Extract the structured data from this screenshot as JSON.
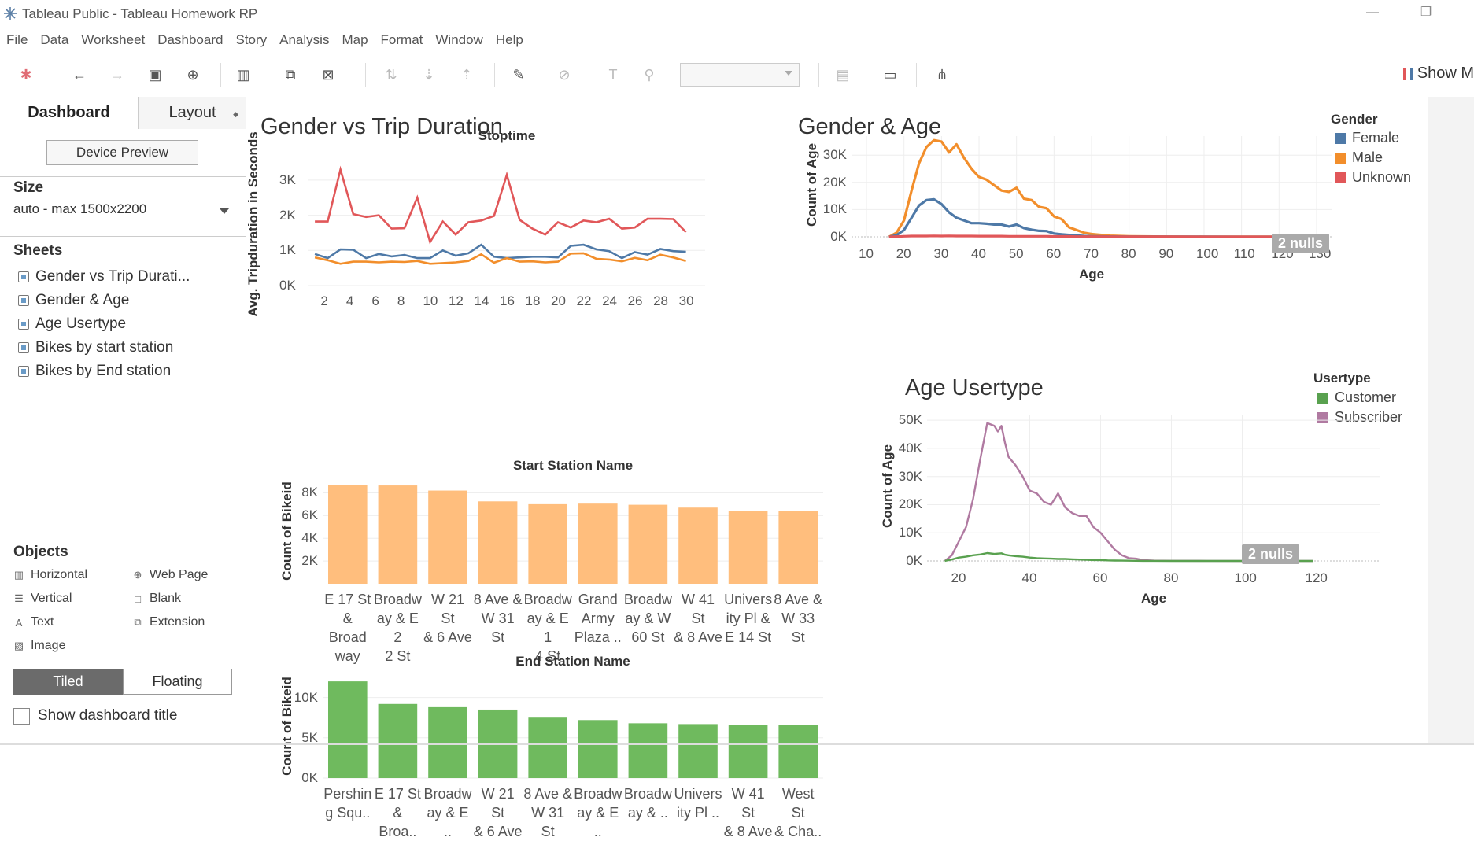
{
  "window": {
    "title": "Tableau Public - Tableau Homework RP"
  },
  "menu": [
    "File",
    "Data",
    "Worksheet",
    "Dashboard",
    "Story",
    "Analysis",
    "Map",
    "Format",
    "Window",
    "Help"
  ],
  "toolbar": {
    "show_me": "Show M"
  },
  "left_pane": {
    "tabs": {
      "dashboard": "Dashboard",
      "layout": "Layout"
    },
    "device_preview": "Device Preview",
    "size": {
      "label": "Size",
      "value": "auto - max 1500x2200"
    },
    "sheets_label": "Sheets",
    "sheets": [
      "Gender vs Trip Durati...",
      "Gender & Age",
      "Age Usertype",
      "Bikes by  start station",
      "Bikes by  End station"
    ],
    "objects_label": "Objects",
    "objects": [
      {
        "label": "Horizontal",
        "icon": "horizontal-container-icon"
      },
      {
        "label": "Web Page",
        "icon": "globe-icon"
      },
      {
        "label": "Vertical",
        "icon": "vertical-container-icon"
      },
      {
        "label": "Blank",
        "icon": "blank-icon"
      },
      {
        "label": "Text",
        "icon": "text-icon"
      },
      {
        "label": "Extension",
        "icon": "puzzle-icon"
      },
      {
        "label": "Image",
        "icon": "image-icon"
      }
    ],
    "tiled": "Tiled",
    "floating": "Floating",
    "show_title": "Show dashboard title"
  },
  "dashboard": {
    "gender_trip_title": "Gender vs Trip Duration",
    "gender_age_title": "Gender & Age",
    "age_usertype_title": "Age Usertype",
    "gender_legend": {
      "title": "Gender",
      "items": [
        "Female",
        "Male",
        "Unknown"
      ]
    },
    "usertype_legend": {
      "title": "Usertype",
      "items": [
        "Customer",
        "Subscriber"
      ]
    },
    "nulls_label": "2 nulls"
  },
  "colors": {
    "female": "#4e79a7",
    "male": "#f28e2b",
    "unknown": "#e15759",
    "customer": "#59a14f",
    "subscriber": "#b07aa1",
    "start_bar": "#ffbe7d",
    "end_bar": "#6fba5e"
  },
  "chart_data": [
    {
      "type": "line",
      "title": "Stoptime",
      "ylabel": "Avg. Tripduration in Seconds",
      "x": [
        1,
        2,
        3,
        4,
        5,
        6,
        7,
        8,
        9,
        10,
        11,
        12,
        13,
        14,
        15,
        16,
        17,
        18,
        19,
        20,
        21,
        22,
        23,
        24,
        25,
        26,
        27,
        28,
        29,
        30,
        31
      ],
      "xticks": [
        "2",
        "4",
        "6",
        "8",
        "10",
        "12",
        "14",
        "16",
        "18",
        "20",
        "22",
        "24",
        "26",
        "28",
        "30"
      ],
      "yticks": [
        "0K",
        "1K",
        "2K",
        "3K"
      ],
      "ylim": [
        0,
        3400
      ],
      "series": [
        {
          "name": "Unknown",
          "values": [
            1820,
            1820,
            3300,
            2030,
            1950,
            2000,
            1620,
            1630,
            2500,
            1240,
            1820,
            1450,
            1800,
            1850,
            1980,
            3150,
            1870,
            1620,
            1450,
            1800,
            1650,
            1850,
            1800,
            1900,
            1620,
            1650,
            1900,
            1900,
            1890,
            1520,
            null
          ]
        },
        {
          "name": "Female",
          "values": [
            900,
            780,
            1030,
            1020,
            780,
            900,
            830,
            870,
            780,
            780,
            1000,
            850,
            920,
            1160,
            820,
            780,
            800,
            820,
            820,
            800,
            1130,
            1160,
            1030,
            980,
            780,
            950,
            880,
            1040,
            980,
            960,
            null
          ]
        },
        {
          "name": "Male",
          "values": [
            800,
            720,
            620,
            680,
            680,
            660,
            680,
            670,
            700,
            620,
            640,
            660,
            700,
            890,
            650,
            780,
            680,
            690,
            660,
            680,
            910,
            920,
            760,
            740,
            690,
            790,
            720,
            880,
            800,
            700,
            null
          ]
        }
      ]
    },
    {
      "type": "line",
      "xlabel": "Age",
      "ylabel": "Count of Age",
      "xticks": [
        "10",
        "20",
        "30",
        "40",
        "50",
        "60",
        "70",
        "80",
        "90",
        "100",
        "110",
        "120",
        "130"
      ],
      "yticks": [
        "0K",
        "10K",
        "20K",
        "30K"
      ],
      "xlim": [
        6,
        134
      ],
      "ylim": [
        0,
        37000
      ],
      "x": [
        16,
        18,
        20,
        22,
        24,
        26,
        28,
        30,
        32,
        34,
        36,
        38,
        40,
        42,
        44,
        46,
        48,
        50,
        52,
        54,
        56,
        58,
        60,
        62,
        64,
        66,
        68,
        70,
        75,
        80,
        90,
        100,
        110,
        119,
        120,
        121,
        130
      ],
      "series": [
        {
          "name": "Male",
          "values": [
            0,
            1500,
            6000,
            17000,
            27000,
            33000,
            35500,
            35000,
            31000,
            34000,
            29000,
            25000,
            22000,
            21000,
            19000,
            17000,
            16500,
            18000,
            14000,
            13500,
            11000,
            10500,
            7500,
            6500,
            3500,
            2500,
            1500,
            1000,
            400,
            200,
            100,
            50,
            30,
            20,
            200,
            20,
            0
          ]
        },
        {
          "name": "Female",
          "values": [
            0,
            600,
            2500,
            7000,
            11500,
            13500,
            13800,
            12000,
            9000,
            7000,
            6000,
            5000,
            5000,
            4800,
            4500,
            4500,
            3800,
            4500,
            3200,
            2600,
            2200,
            2100,
            1200,
            900,
            700,
            500,
            300,
            200,
            100,
            50,
            30,
            20,
            10,
            5,
            5,
            5,
            0
          ]
        },
        {
          "name": "Unknown",
          "values": [
            0,
            100,
            200,
            300,
            300,
            300,
            350,
            300,
            350,
            300,
            300,
            300,
            250,
            250,
            250,
            250,
            200,
            200,
            200,
            200,
            200,
            200,
            150,
            150,
            150,
            100,
            100,
            100,
            50,
            30,
            20,
            10,
            10,
            10,
            10,
            10,
            0
          ]
        }
      ]
    },
    {
      "type": "line",
      "xlabel": "Age",
      "ylabel": "Count of Age",
      "xticks": [
        "20",
        "40",
        "60",
        "80",
        "100",
        "120"
      ],
      "yticks": [
        "0K",
        "10K",
        "20K",
        "30K",
        "40K",
        "50K"
      ],
      "xlim": [
        11,
        139
      ],
      "ylim": [
        0,
        52000
      ],
      "x": [
        16,
        18,
        20,
        22,
        24,
        26,
        28,
        30,
        31,
        32,
        33,
        34,
        36,
        38,
        40,
        42,
        44,
        46,
        48,
        50,
        52,
        54,
        56,
        58,
        60,
        62,
        64,
        66,
        68,
        70,
        72,
        75,
        80,
        90,
        100,
        110,
        120
      ],
      "series": [
        {
          "name": "Subscriber",
          "values": [
            0,
            2000,
            7000,
            12000,
            22000,
            36000,
            49000,
            48000,
            46000,
            48000,
            42000,
            37000,
            34000,
            30000,
            25000,
            24000,
            21000,
            20000,
            24000,
            19000,
            17000,
            16000,
            16000,
            12000,
            10000,
            7000,
            4000,
            2000,
            1000,
            800,
            300,
            100,
            50,
            20,
            10,
            5,
            0
          ]
        },
        {
          "name": "Customer",
          "values": [
            0,
            500,
            1200,
            1500,
            2000,
            2300,
            2800,
            2500,
            2600,
            2700,
            2200,
            2000,
            1700,
            1500,
            1200,
            1000,
            900,
            800,
            700,
            700,
            600,
            500,
            400,
            300,
            300,
            200,
            150,
            100,
            80,
            50,
            30,
            20,
            10,
            5,
            5,
            5,
            0
          ]
        }
      ]
    },
    {
      "type": "bar",
      "title": "Start Station Name",
      "ylabel": "Count of Bikeid",
      "yticks": [
        "2K",
        "4K",
        "6K",
        "8K"
      ],
      "ylim": [
        0,
        9000
      ],
      "categories": [
        "E 17 St & Broad way",
        "Broadw ay & E 2 2 St",
        "W 21 St & 6 Ave",
        "8 Ave & W 31 St",
        "Broadw ay & E 1 4 St",
        "Grand Army Plaza ..",
        "Broadw ay & W 60 St",
        "W 41 St & 8 Ave",
        "Univers ity Pl & E 14 St",
        "8 Ave & W 33 St"
      ],
      "category_lines": [
        [
          "E 17 St",
          "& Broad",
          "way"
        ],
        [
          "Broadw",
          "ay & E 2",
          "2 St"
        ],
        [
          "W 21 St",
          "& 6 Ave"
        ],
        [
          "8 Ave &",
          "W 31 St"
        ],
        [
          "Broadw",
          "ay & E 1",
          "4 St"
        ],
        [
          "Grand",
          "Army",
          "Plaza .."
        ],
        [
          "Broadw",
          "ay & W",
          "60 St"
        ],
        [
          "W 41 St",
          "& 8 Ave"
        ],
        [
          "Univers",
          "ity Pl &",
          "E 14 St"
        ],
        [
          "8 Ave &",
          "W 33 St"
        ]
      ],
      "values": [
        8700,
        8650,
        8200,
        7250,
        7000,
        7050,
        6950,
        6700,
        6400,
        6400
      ]
    },
    {
      "type": "bar",
      "title": "End Station Name",
      "ylabel": "Count of Bikeid",
      "yticks": [
        "0K",
        "5K",
        "10K"
      ],
      "ylim": [
        0,
        12500
      ],
      "categories": [
        "Pershin g Squ..",
        "E 17 St & Broa..",
        "Broadw ay & E ..",
        "W 21 St & 6 Ave",
        "8 Ave & W 31 St",
        "Broadw ay & E ..",
        "Broadw ay & ..",
        "Univers ity Pl ..",
        "W 41 St & 8 Ave",
        "West St & Cha.."
      ],
      "category_lines": [
        [
          "Pershin",
          "g Squ.."
        ],
        [
          "E 17 St",
          "& Broa.."
        ],
        [
          "Broadw",
          "ay & E .."
        ],
        [
          "W 21 St",
          "& 6 Ave"
        ],
        [
          "8 Ave &",
          "W 31 St"
        ],
        [
          "Broadw",
          "ay & E .."
        ],
        [
          "Broadw",
          "ay & .."
        ],
        [
          "Univers",
          "ity Pl .."
        ],
        [
          "W 41 St",
          "& 8 Ave"
        ],
        [
          "West St",
          "& Cha.."
        ]
      ],
      "values": [
        12000,
        9200,
        8800,
        8500,
        7500,
        7200,
        6800,
        6700,
        6600,
        6600
      ]
    }
  ]
}
